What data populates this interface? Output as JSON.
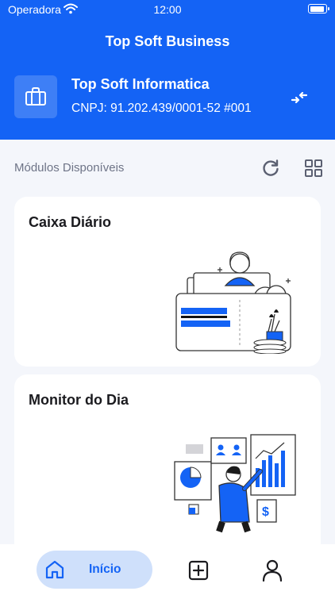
{
  "status_bar": {
    "carrier": "Operadora",
    "time": "12:00"
  },
  "header": {
    "title": "Top Soft Business",
    "company_name": "Top Soft Informatica",
    "company_cnpj": "CNPJ: 91.202.439/0001-52 #001"
  },
  "modules": {
    "section_title": "Módulos Disponíveis",
    "cards": [
      {
        "title": "Caixa Diário"
      },
      {
        "title": "Monitor do Dia"
      }
    ]
  },
  "tabbar": {
    "home_label": "Início"
  },
  "colors": {
    "primary": "#1463f5",
    "background": "#f4f6fb",
    "active_tab": "#cfe0fb"
  }
}
